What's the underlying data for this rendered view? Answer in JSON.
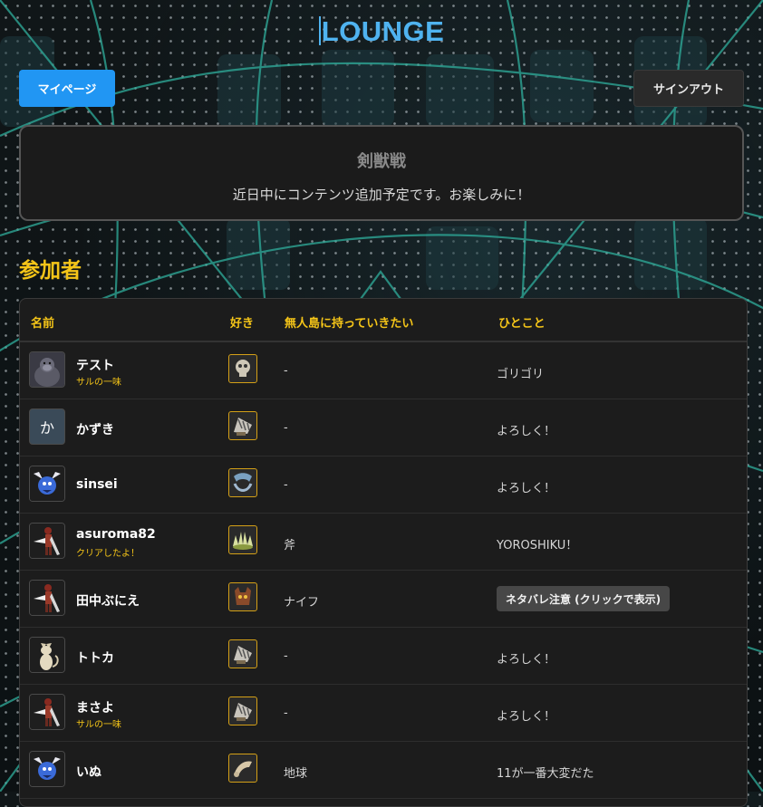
{
  "header": {
    "title": "LOUNGE"
  },
  "nav": {
    "mypage_label": "マイページ",
    "signout_label": "サインアウト"
  },
  "notice": {
    "title": "剣獣戦",
    "text": "近日中にコンテンツ追加予定です。お楽しみに！"
  },
  "participants": {
    "heading": "参加者",
    "columns": {
      "name": "名前",
      "like": "好き",
      "island": "無人島に持っていきたい",
      "comment": "ひとこと"
    },
    "rows": [
      {
        "name": "テスト",
        "tag": "サルの一味",
        "avatar": "gorilla",
        "like_icon": "skull-icon",
        "island": "-",
        "comment": "ゴリゴリ"
      },
      {
        "name": "かずき",
        "tag": "",
        "avatar": "letter",
        "avatar_letter": "か",
        "like_icon": "claw-icon",
        "island": "-",
        "comment": "よろしく！"
      },
      {
        "name": "sinsei",
        "tag": "",
        "avatar": "blue-bird",
        "like_icon": "beast-icon",
        "island": "-",
        "comment": "よろしく！"
      },
      {
        "name": "asuroma82",
        "tag": "クリアしたよ！",
        "avatar": "warrior",
        "like_icon": "spike-icon",
        "island": "斧",
        "comment": "YOROSHIKU！"
      },
      {
        "name": "田中ぶにえ",
        "tag": "",
        "avatar": "warrior",
        "like_icon": "demon-icon",
        "island": "ナイフ",
        "comment": "",
        "spoiler": "ネタバレ注意 (クリックで表示)"
      },
      {
        "name": "トトカ",
        "tag": "",
        "avatar": "cat",
        "like_icon": "claw-icon",
        "island": "-",
        "comment": "よろしく！"
      },
      {
        "name": "まさよ",
        "tag": "サルの一味",
        "avatar": "warrior",
        "like_icon": "claw-icon",
        "island": "-",
        "comment": "よろしく！"
      },
      {
        "name": "いぬ",
        "tag": "",
        "avatar": "blue-bird",
        "like_icon": "bone-icon",
        "island": "地球",
        "comment": "11が一番大変だた"
      }
    ]
  },
  "colors": {
    "accent": "#2196f3",
    "title": "#4fb3f0",
    "heading": "#f5c518",
    "background": "#0d1214"
  }
}
